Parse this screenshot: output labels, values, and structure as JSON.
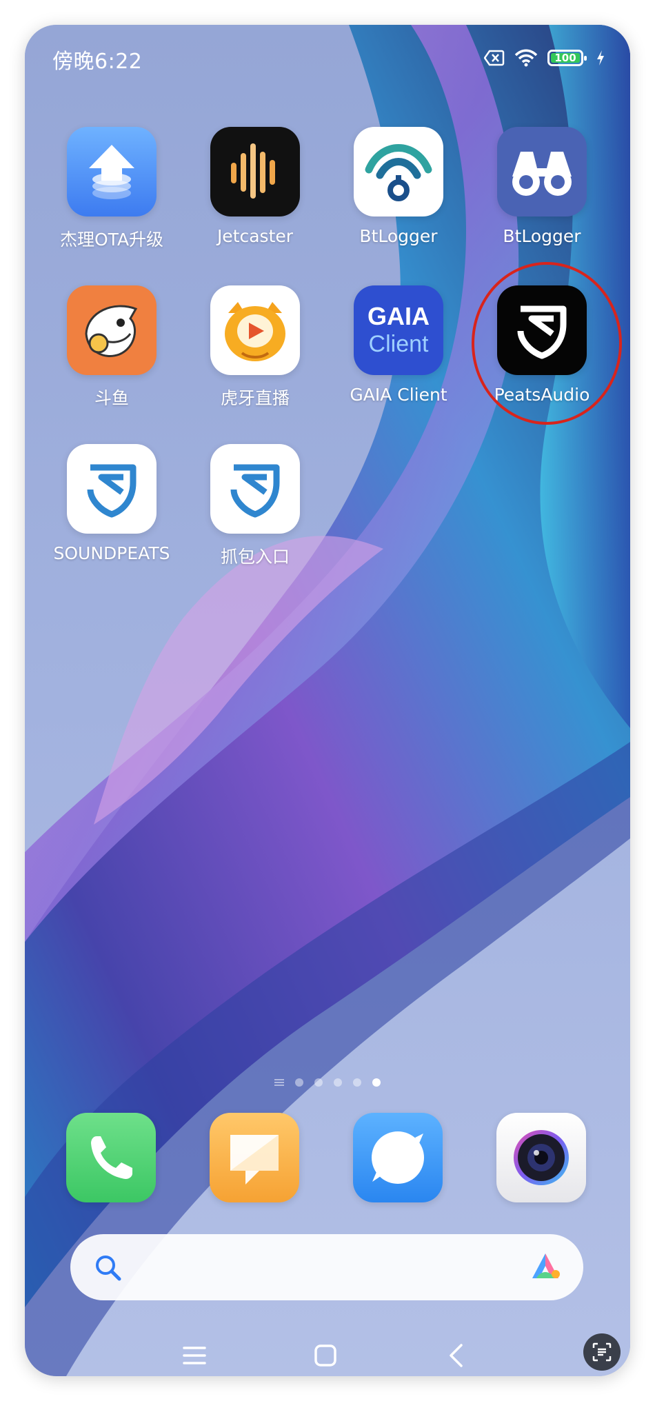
{
  "status_bar": {
    "time": "傍晚6:22",
    "battery_level": "100",
    "icons": [
      "sim-off-icon",
      "wifi-icon",
      "battery-icon",
      "charging-bolt-icon"
    ]
  },
  "apps": [
    {
      "label": "杰理OTA升级",
      "icon": "upload-arrow-icon"
    },
    {
      "label": "Jetcaster",
      "icon": "audio-bars-icon"
    },
    {
      "label": "BtLogger",
      "icon": "signal-waves-icon"
    },
    {
      "label": "BtLogger",
      "icon": "binoculars-icon"
    },
    {
      "label": "斗鱼",
      "icon": "shark-mascot-icon"
    },
    {
      "label": "虎牙直播",
      "icon": "tiger-mascot-icon"
    },
    {
      "label": "GAIA Client",
      "icon_text_line1": "GAIA",
      "icon_text_line2": "Client"
    },
    {
      "label": "PeatsAudio",
      "icon": "s-shield-icon"
    },
    {
      "label": "SOUNDPEATS",
      "icon": "s-shield-icon"
    },
    {
      "label": "抓包入口",
      "icon": "s-shield-icon"
    }
  ],
  "page_indicator": {
    "pages": 5,
    "active_index": 4
  },
  "dock": [
    {
      "icon": "phone-icon"
    },
    {
      "icon": "notes-icon"
    },
    {
      "icon": "browser-icon"
    },
    {
      "icon": "camera-icon"
    }
  ],
  "search": {
    "icon": "search-icon",
    "assistant_icon": "assistant-logo-icon"
  },
  "nav": [
    "menu-icon",
    "home-icon",
    "back-icon",
    "scan-icon"
  ],
  "colors": {
    "annotation": "#d8241c",
    "accent_blue": "#2f7bf5"
  }
}
